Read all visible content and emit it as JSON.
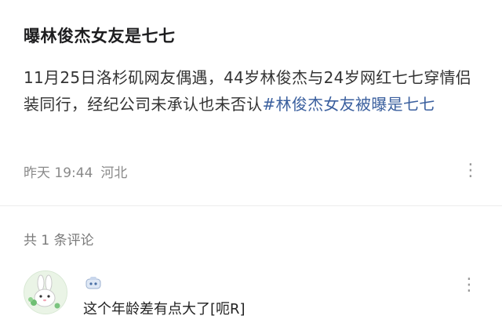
{
  "post": {
    "title": "曝林俊杰女友是七七",
    "text_plain": "11月25日洛杉矶网友偶遇，44岁林俊杰与24岁网红七七穿情侣装同行，经纪公司未承认也未否认",
    "hashtag": "#林俊杰女友被曝是七七",
    "time": "昨天 19:44",
    "location": "河北",
    "more_icon": "more-horizontal-icon",
    "hashtag_color": "#3a5f9e"
  },
  "comments": {
    "count_label": "共 1 条评论",
    "items": [
      {
        "avatar_icon": "rabbit-avatar-icon",
        "badge_icon": "robot-badge-icon",
        "text": "这个年龄差有点大了[呃R]",
        "more_icon": "more-horizontal-icon"
      }
    ]
  }
}
